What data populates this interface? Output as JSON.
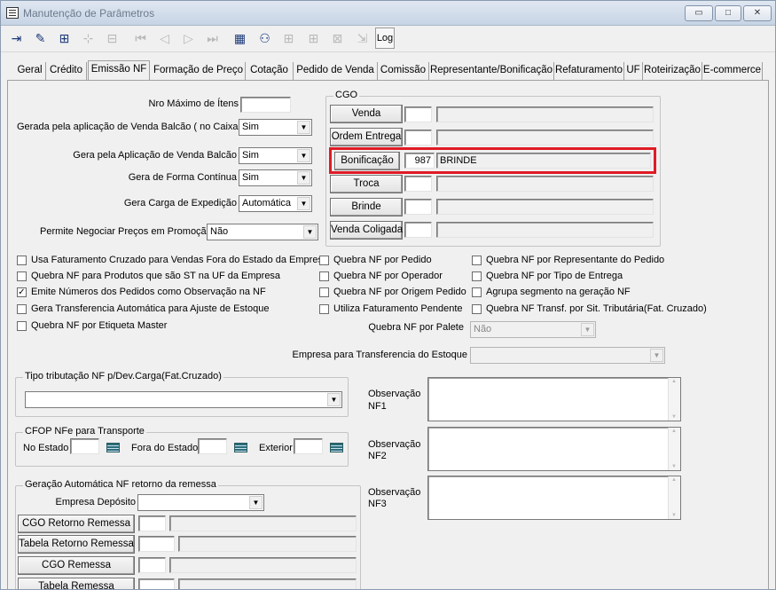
{
  "window": {
    "title": "Manutenção de Parâmetros",
    "min_label": "▭",
    "max_label": "□",
    "close_label": "✕"
  },
  "toolbar": {
    "log_label": "Log"
  },
  "tabs": [
    "Geral",
    "Crédito",
    "Emissão NF",
    "Formação de Preço",
    "Cotação",
    "Pedido de Venda",
    "Comissão",
    "Representante/Bonificação",
    "Refaturamento",
    "UF",
    "Roteirização",
    "E-commerce"
  ],
  "form": {
    "nro_max_itens_label": "Nro Máximo de Ítens",
    "nro_max_itens_value": "",
    "gerada_balcao_label": "Gerada pela aplicação de Venda Balcão ( no Caixa )",
    "gerada_balcao_value": "Sim",
    "gera_app_balcao_label": "Gera pela Aplicação de Venda Balcão",
    "gera_app_balcao_value": "Sim",
    "forma_continua_label": "Gera de Forma Contínua",
    "forma_continua_value": "Sim",
    "carga_exped_label": "Gera Carga de Expedição",
    "carga_exped_value": "Automática",
    "negociar_label": "Permite Negociar Preços em Promoção",
    "negociar_value": "Não"
  },
  "cgo": {
    "title": "CGO",
    "rows": [
      {
        "label": "Venda",
        "code": "",
        "desc": ""
      },
      {
        "label": "Ordem Entrega",
        "code": "",
        "desc": ""
      },
      {
        "label": "Bonificação",
        "code": "987",
        "desc": "BRINDE"
      },
      {
        "label": "Troca",
        "code": "",
        "desc": ""
      },
      {
        "label": "Brinde",
        "code": "",
        "desc": ""
      },
      {
        "label": "Venda Coligada",
        "code": "",
        "desc": ""
      }
    ]
  },
  "checks": {
    "c1": {
      "label": "Usa Faturamento Cruzado para Vendas Fora do Estado da Empresa",
      "mark": ""
    },
    "c2": {
      "label": "Quebra NF para Produtos que são ST na UF da Empresa",
      "mark": ""
    },
    "c3": {
      "label": "Emite Números dos Pedidos como Observação na NF",
      "mark": "✓"
    },
    "c4": {
      "label": "Gera Transferencia Automática para Ajuste de Estoque",
      "mark": ""
    },
    "c5": {
      "label": "Quebra NF por Etiqueta Master",
      "mark": ""
    },
    "c6": {
      "label": "Quebra NF por Pedido",
      "mark": ""
    },
    "c7": {
      "label": "Quebra NF por Operador",
      "mark": ""
    },
    "c8": {
      "label": "Quebra NF por Origem Pedido",
      "mark": ""
    },
    "c9": {
      "label": "Utiliza Faturamento Pendente",
      "mark": ""
    },
    "c10": {
      "label": "Quebra NF por Representante do Pedido",
      "mark": ""
    },
    "c11": {
      "label": "Quebra NF por Tipo de Entrega",
      "mark": ""
    },
    "c12": {
      "label": "Agrupa segmento na geração NF",
      "mark": ""
    },
    "c13": {
      "label": "Quebra NF Transf. por Sit. Tributária(Fat. Cruzado)",
      "mark": ""
    }
  },
  "palete": {
    "label": "Quebra NF por Palete",
    "value": "Não"
  },
  "empresa_transf": {
    "label": "Empresa para Transferencia do Estoque",
    "value": ""
  },
  "tipo_trib": {
    "title": "Tipo tributação NF p/Dev.Carga(Fat.Cruzado)",
    "value": ""
  },
  "cfop": {
    "title": "CFOP NFe para Transporte",
    "no_estado": "No Estado",
    "fora_estado": "Fora do Estado",
    "exterior": "Exterior"
  },
  "obs": {
    "nf1_a": "Observação",
    "nf1_b": "NF1",
    "nf2_a": "Observação",
    "nf2_b": "NF2",
    "nf3_a": "Observação",
    "nf3_b": "NF3"
  },
  "retorno": {
    "title": "Geração Automática NF retorno da remessa",
    "empresa_label": "Empresa Depósito",
    "empresa_value": "",
    "cgo_retorno": "CGO Retorno Remessa",
    "tabela_retorno": "Tabela Retorno Remessa",
    "cgo_remessa": "CGO Remessa",
    "tabela_remessa": "Tabela Remessa"
  }
}
